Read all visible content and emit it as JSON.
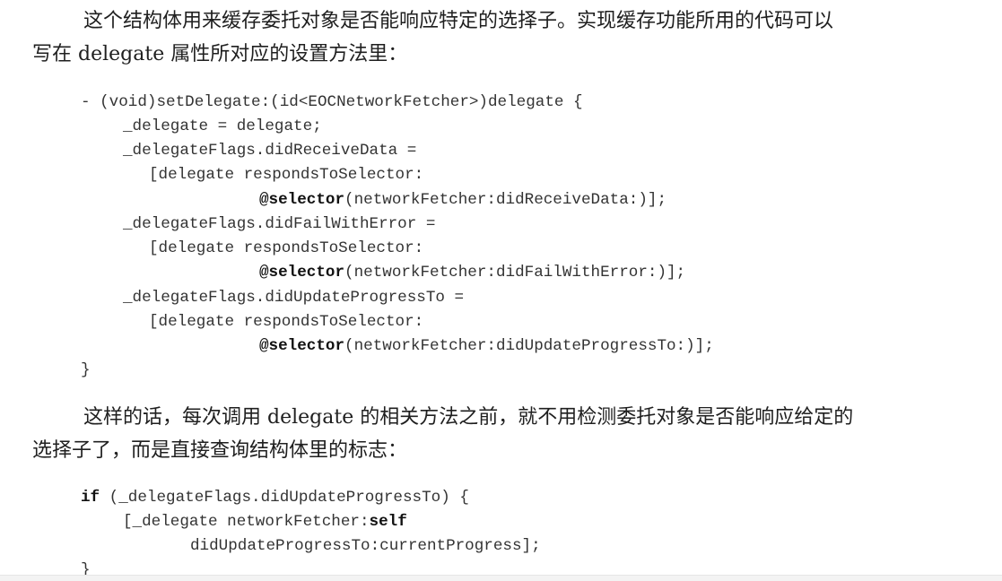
{
  "paragraphs": [
    {
      "line1": "这个结构体用来缓存委托对象是否能响应特定的选择子。实现缓存功能所用的代码可以",
      "line2": "写在 delegate 属性所对应的设置方法里："
    },
    {
      "line1": "这样的话，每次调用 delegate 的相关方法之前，就不用检测委托对象是否能响应给定的",
      "line2": "选择子了，而是直接查询结构体里的标志："
    }
  ],
  "code1": {
    "l1": "- (void)setDelegate:(id<EOCNetworkFetcher>)delegate {",
    "l2": "_delegate = delegate;",
    "l3": "_delegateFlags.didReceiveData =",
    "l4": "[delegate respondsToSelector:",
    "l5_kw": "@selector",
    "l5_rest": "(networkFetcher:didReceiveData:)];",
    "l6": "_delegateFlags.didFailWithError =",
    "l7": "[delegate respondsToSelector:",
    "l8_kw": "@selector",
    "l8_rest": "(networkFetcher:didFailWithError:)];",
    "l9": "_delegateFlags.didUpdateProgressTo =",
    "l10": "[delegate respondsToSelector:",
    "l11_kw": "@selector",
    "l11_rest": "(networkFetcher:didUpdateProgressTo:)];",
    "l12": "}"
  },
  "code2": {
    "l1_kw": "if",
    "l1_rest": " (_delegateFlags.didUpdateProgressTo) {",
    "l2_pre": "[_delegate networkFetcher:",
    "l2_kw": "self",
    "l3": "didUpdateProgressTo:currentProgress];",
    "l4": "}"
  }
}
